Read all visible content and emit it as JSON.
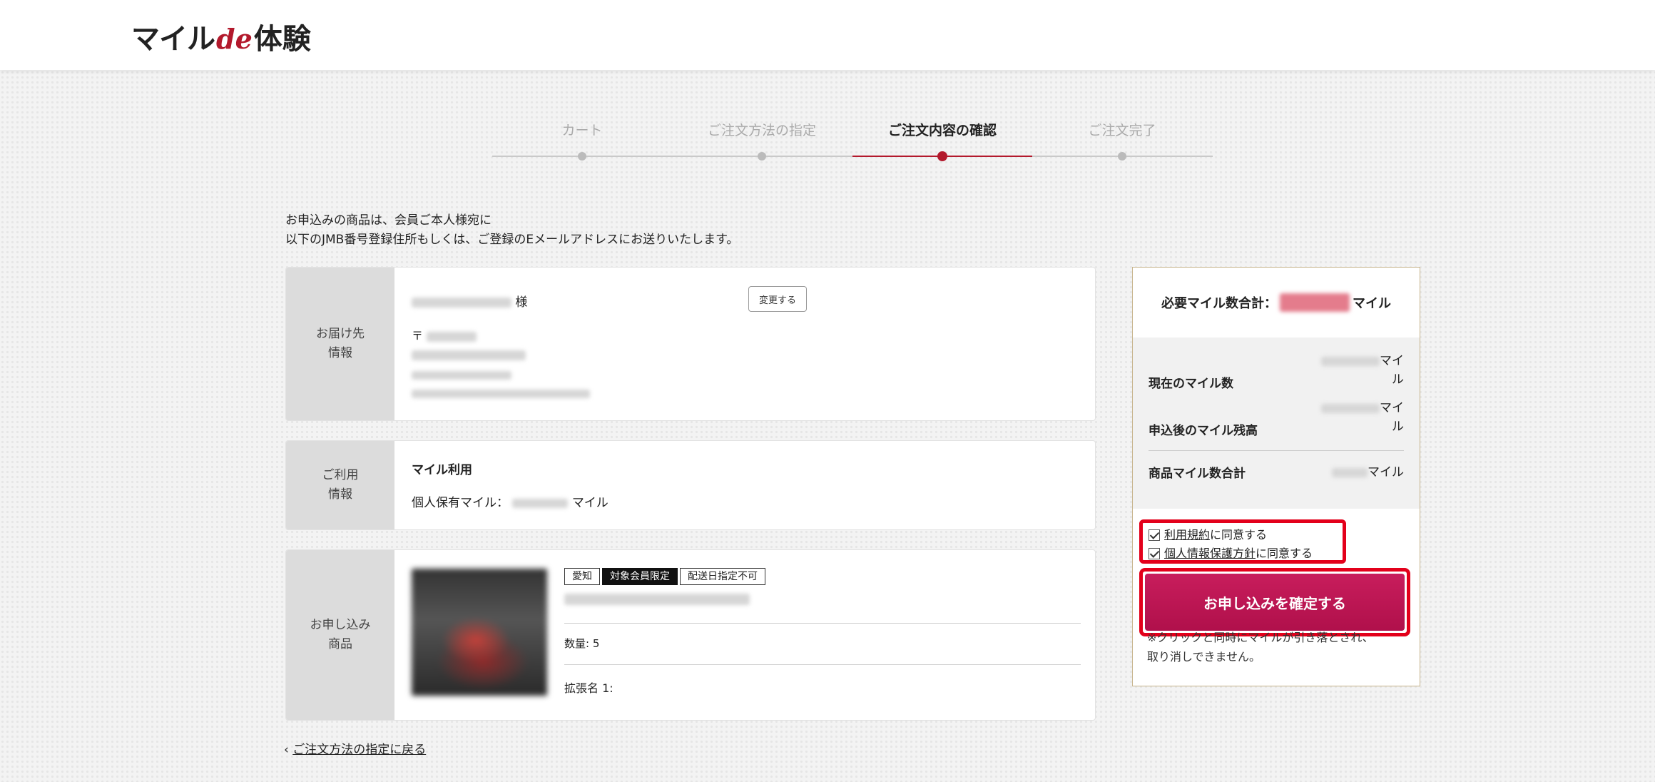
{
  "header": {
    "logo_part1": "マイル",
    "logo_part2": "de",
    "logo_part3": "体験"
  },
  "stepper": {
    "steps": [
      {
        "label": "カート",
        "state": "done"
      },
      {
        "label": "ご注文方法の指定",
        "state": "done"
      },
      {
        "label": "ご注文内容の確認",
        "state": "current"
      },
      {
        "label": "ご注文完了",
        "state": "upcoming"
      }
    ]
  },
  "intro": {
    "line1": "お申込みの商品は、会員ご本人様宛に",
    "line2": "以下のJMB番号登録住所もしくは、ご登録のEメールアドレスにお送りいたします。"
  },
  "delivery": {
    "side_label_1": "お届け先",
    "side_label_2": "情報",
    "name_suffix": "様",
    "change_button": "変更する",
    "postal_mark": "〒"
  },
  "usage": {
    "side_label_1": "ご利用",
    "side_label_2": "情報",
    "title": "マイル利用",
    "personal_label": "個人保有マイル：",
    "unit": "マイル"
  },
  "product": {
    "side_label_1": "お申し込み",
    "side_label_2": "商品",
    "tags": [
      "愛知",
      "対象会員限定",
      "配送日指定不可"
    ],
    "quantity_label": "数量: 5",
    "extension_label": "拡張名 1:"
  },
  "back_link": {
    "chevron": "‹",
    "label": "ご注文方法の指定に戻る"
  },
  "summary": {
    "required_label": "必要マイル数合計：",
    "unit": "マイル",
    "current_label": "現在のマイル数",
    "current_unit_1": "マイ",
    "current_unit_2": "ル",
    "after_label": "申込後のマイル残高",
    "after_unit_1": "マイ",
    "after_unit_2": "ル",
    "product_total_label": "商品マイル数合計",
    "product_total_unit": "マイル"
  },
  "agreement": {
    "terms_link": "利用規約",
    "terms_suffix": "に同意する",
    "privacy_link": "個人情報保護方針",
    "privacy_suffix": "に同意する"
  },
  "confirm": {
    "button_label": "お申し込みを確定する",
    "note_line1": "※クリックと同時にマイルが引き落とされ、",
    "note_line2": "取り消しできません。"
  },
  "colors": {
    "accent_red": "#b3192c",
    "highlight_red": "#e3001b",
    "confirm_button": "#c01556",
    "summary_border": "#c7b48c"
  }
}
